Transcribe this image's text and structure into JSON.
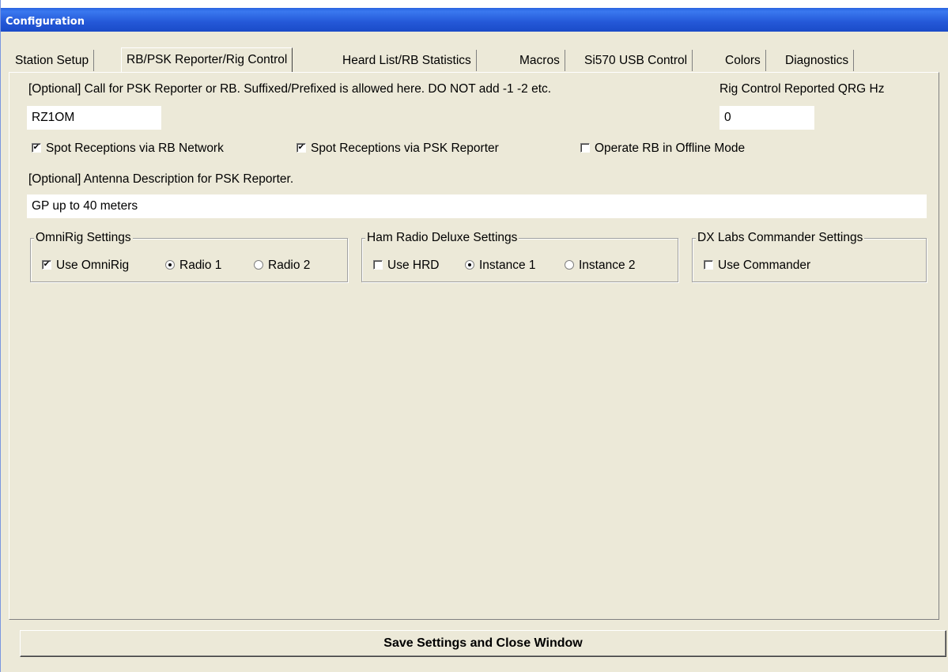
{
  "window": {
    "title": "Configuration"
  },
  "tabs": [
    {
      "label": "Station Setup"
    },
    {
      "label": "RB/PSK Reporter/Rig Control"
    },
    {
      "label": "Heard List/RB Statistics"
    },
    {
      "label": "Macros"
    },
    {
      "label": "Si570 USB Control"
    },
    {
      "label": "Colors"
    },
    {
      "label": "Diagnostics"
    }
  ],
  "active_tab": "RB/PSK Reporter/Rig Control",
  "call": {
    "label": "[Optional] Call for PSK Reporter or RB.  Suffixed/Prefixed is allowed here.  DO NOT add -1 -2 etc.",
    "value": "RZ1OM"
  },
  "qrg": {
    "label": "Rig Control Reported QRG Hz",
    "value": "0"
  },
  "options": {
    "spot_rb": {
      "label": "Spot Receptions via RB Network",
      "checked": true
    },
    "spot_psk": {
      "label": "Spot Receptions via PSK Reporter",
      "checked": true
    },
    "offline": {
      "label": "Operate RB in Offline Mode",
      "checked": false
    }
  },
  "antenna": {
    "label": "[Optional] Antenna Description for PSK Reporter.",
    "value": "GP up to 40 meters"
  },
  "omnirig": {
    "legend": "OmniRig Settings",
    "use_label": "Use OmniRig",
    "use_checked": true,
    "radio1": "Radio 1",
    "radio2": "Radio 2",
    "selected": "Radio 1"
  },
  "hrd": {
    "legend": "Ham Radio Deluxe Settings",
    "use_label": "Use HRD",
    "use_checked": false,
    "instance1": "Instance 1",
    "instance2": "Instance 2",
    "selected": "Instance 1"
  },
  "commander": {
    "legend": "DX Labs Commander Settings",
    "use_label": "Use Commander",
    "use_checked": false
  },
  "save_button": {
    "label": "Save Settings and Close Window"
  }
}
